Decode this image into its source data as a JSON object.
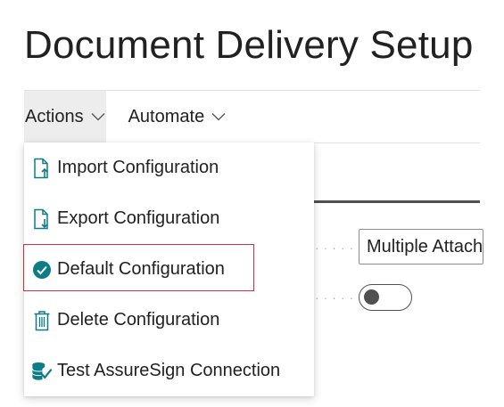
{
  "page": {
    "title": "Document Delivery Setup"
  },
  "action_bar": {
    "actions_label": "Actions",
    "automate_label": "Automate"
  },
  "menu": {
    "items": [
      {
        "label": "Import Configuration",
        "icon": "import-document-icon"
      },
      {
        "label": "Export Configuration",
        "icon": "export-document-icon"
      },
      {
        "label": "Default Configuration",
        "icon": "check-circle-icon"
      },
      {
        "label": "Delete Configuration",
        "icon": "trash-icon"
      },
      {
        "label": "Test AssureSign Connection",
        "icon": "database-check-icon"
      }
    ]
  },
  "background_fields": {
    "attachment_value": "Multiple Attachments",
    "toggle_state": "off"
  },
  "colors": {
    "accent_teal": "#0e7c86",
    "highlight_red": "#c9343f",
    "text": "#212121"
  }
}
